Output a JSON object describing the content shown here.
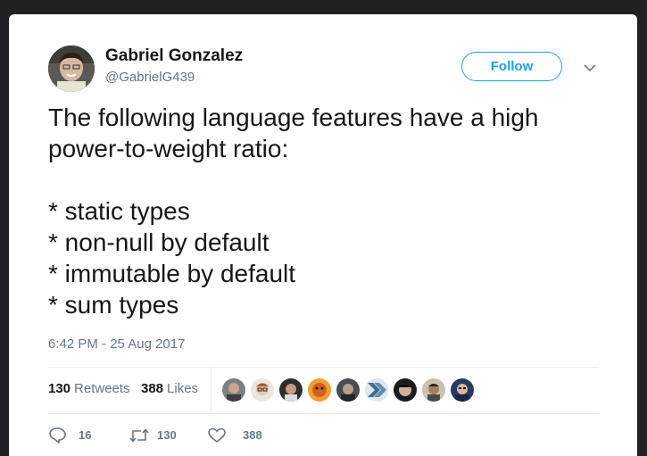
{
  "tweet": {
    "author_name": "Gabriel Gonzalez",
    "author_handle": "@GabrielG439",
    "follow_label": "Follow",
    "text_lines": [
      "The following language features have a high",
      "power-to-weight ratio:",
      "",
      "* static types",
      "* non-null by default",
      "* immutable by default",
      "* sum types"
    ],
    "timestamp": "6:42 PM - 25 Aug 2017"
  },
  "stats": {
    "retweets_count": "130",
    "retweets_label": "Retweets",
    "likes_count": "388",
    "likes_label": "Likes"
  },
  "actions": {
    "reply_count": "16",
    "retweet_count": "130",
    "like_count": "388"
  },
  "colors": {
    "accent": "#1da1f2",
    "text": "#14171a",
    "secondary": "#657786",
    "divider": "#e6ecf0"
  }
}
